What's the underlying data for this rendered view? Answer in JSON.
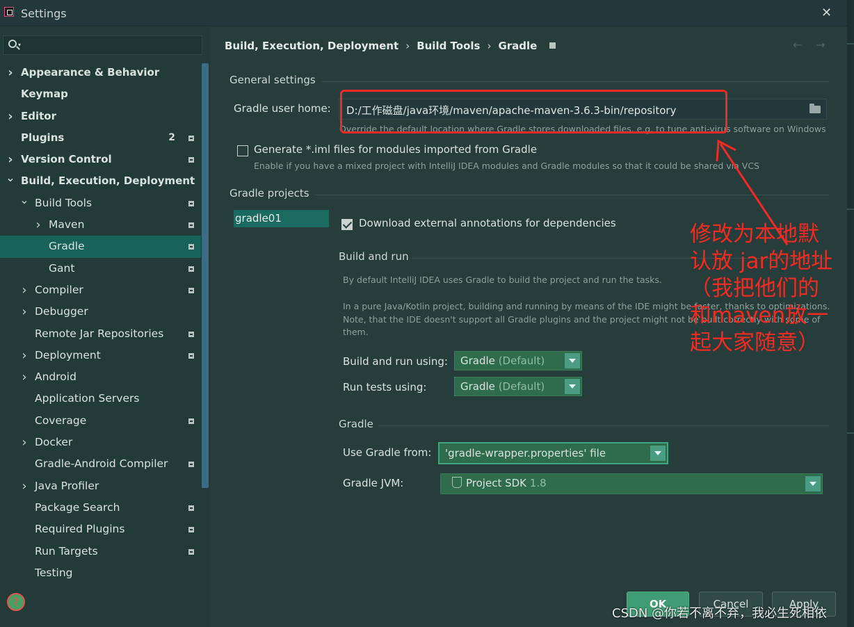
{
  "window": {
    "title": "Settings"
  },
  "search": {
    "placeholder": ""
  },
  "sidebar": {
    "items": [
      {
        "label": "Appearance & Behavior",
        "bold": true,
        "arrow": "right",
        "indent": 0
      },
      {
        "label": "Keymap",
        "bold": true,
        "arrow": "",
        "indent": 0
      },
      {
        "label": "Editor",
        "bold": true,
        "arrow": "right",
        "indent": 0
      },
      {
        "label": "Plugins",
        "bold": true,
        "arrow": "",
        "indent": 0,
        "badge": "2",
        "project": true
      },
      {
        "label": "Version Control",
        "bold": true,
        "arrow": "right",
        "indent": 0,
        "project": true
      },
      {
        "label": "Build, Execution, Deployment",
        "bold": true,
        "arrow": "down",
        "indent": 0
      },
      {
        "label": "Build Tools",
        "bold": false,
        "arrow": "down",
        "indent": 1,
        "project": true
      },
      {
        "label": "Maven",
        "bold": false,
        "arrow": "right",
        "indent": 2,
        "project": true
      },
      {
        "label": "Gradle",
        "bold": false,
        "arrow": "",
        "indent": 2,
        "project": true,
        "selected": true
      },
      {
        "label": "Gant",
        "bold": false,
        "arrow": "",
        "indent": 2,
        "project": true
      },
      {
        "label": "Compiler",
        "bold": false,
        "arrow": "right",
        "indent": 1,
        "project": true
      },
      {
        "label": "Debugger",
        "bold": false,
        "arrow": "right",
        "indent": 1
      },
      {
        "label": "Remote Jar Repositories",
        "bold": false,
        "arrow": "",
        "indent": 1,
        "project": true
      },
      {
        "label": "Deployment",
        "bold": false,
        "arrow": "right",
        "indent": 1,
        "project": true
      },
      {
        "label": "Android",
        "bold": false,
        "arrow": "right",
        "indent": 1
      },
      {
        "label": "Application Servers",
        "bold": false,
        "arrow": "",
        "indent": 1
      },
      {
        "label": "Coverage",
        "bold": false,
        "arrow": "",
        "indent": 1,
        "project": true
      },
      {
        "label": "Docker",
        "bold": false,
        "arrow": "right",
        "indent": 1
      },
      {
        "label": "Gradle-Android Compiler",
        "bold": false,
        "arrow": "",
        "indent": 1,
        "project": true
      },
      {
        "label": "Java Profiler",
        "bold": false,
        "arrow": "right",
        "indent": 1
      },
      {
        "label": "Package Search",
        "bold": false,
        "arrow": "",
        "indent": 1,
        "project": true
      },
      {
        "label": "Required Plugins",
        "bold": false,
        "arrow": "",
        "indent": 1,
        "project": true
      },
      {
        "label": "Run Targets",
        "bold": false,
        "arrow": "",
        "indent": 1,
        "project": true
      },
      {
        "label": "Testing",
        "bold": false,
        "arrow": "",
        "indent": 1
      }
    ]
  },
  "breadcrumb": {
    "part1": "Build, Execution, Deployment",
    "part2": "Build Tools",
    "part3": "Gradle"
  },
  "general": {
    "heading": "General settings",
    "user_home_label": "Gradle user home:",
    "user_home_value": "D:/工作磁盘/java环境/maven/apache-maven-3.6.3-bin/repository",
    "user_home_hint": "Override the default location where Gradle stores downloaded files, e.g. to tune anti-virus software on Windows",
    "iml_label": "Generate *.iml files for modules imported from Gradle",
    "iml_checked": false,
    "iml_hint": "Enable if you have a mixed project with IntelliJ IDEA modules and Gradle modules so that it could be shared via VCS"
  },
  "projects": {
    "heading": "Gradle projects",
    "list": [
      "gradle01"
    ],
    "download_annotations_label": "Download external annotations for dependencies",
    "download_annotations_checked": true
  },
  "build_and_run": {
    "heading": "Build and run",
    "desc1": "By default IntelliJ IDEA uses Gradle to build the project and run the tasks.",
    "desc2": "In a pure Java/Kotlin project, building and running by means of the IDE might be faster, thanks to optimizations.",
    "desc3": "Note, that the IDE doesn't support all Gradle plugins and the project might not be built correctly with some of",
    "desc4": "them.",
    "build_run_label": "Build and run using:",
    "build_run_value": "Gradle",
    "build_run_suffix": "(Default)",
    "run_tests_label": "Run tests using:",
    "run_tests_value": "Gradle",
    "run_tests_suffix": "(Default)"
  },
  "gradle": {
    "heading": "Gradle",
    "use_from_label": "Use Gradle from:",
    "use_from_value": "'gradle-wrapper.properties' file",
    "jvm_label": "Gradle JVM:",
    "jvm_value": "Project SDK",
    "jvm_version": "1.8"
  },
  "buttons": {
    "ok": "OK",
    "cancel": "Cancel",
    "apply": "Apply"
  },
  "annotation": {
    "color": "#f32a20",
    "lines": [
      "修改为本地默",
      "认放 jar的地址",
      "（我把他们的",
      "和maven放一",
      "起大家随意）"
    ]
  },
  "watermark": "CSDN @你若不离不弃，我必生死相依",
  "colors": {
    "accent": "#18625a",
    "ok_button": "#3f9c74",
    "combo": "#2f6c4b"
  }
}
